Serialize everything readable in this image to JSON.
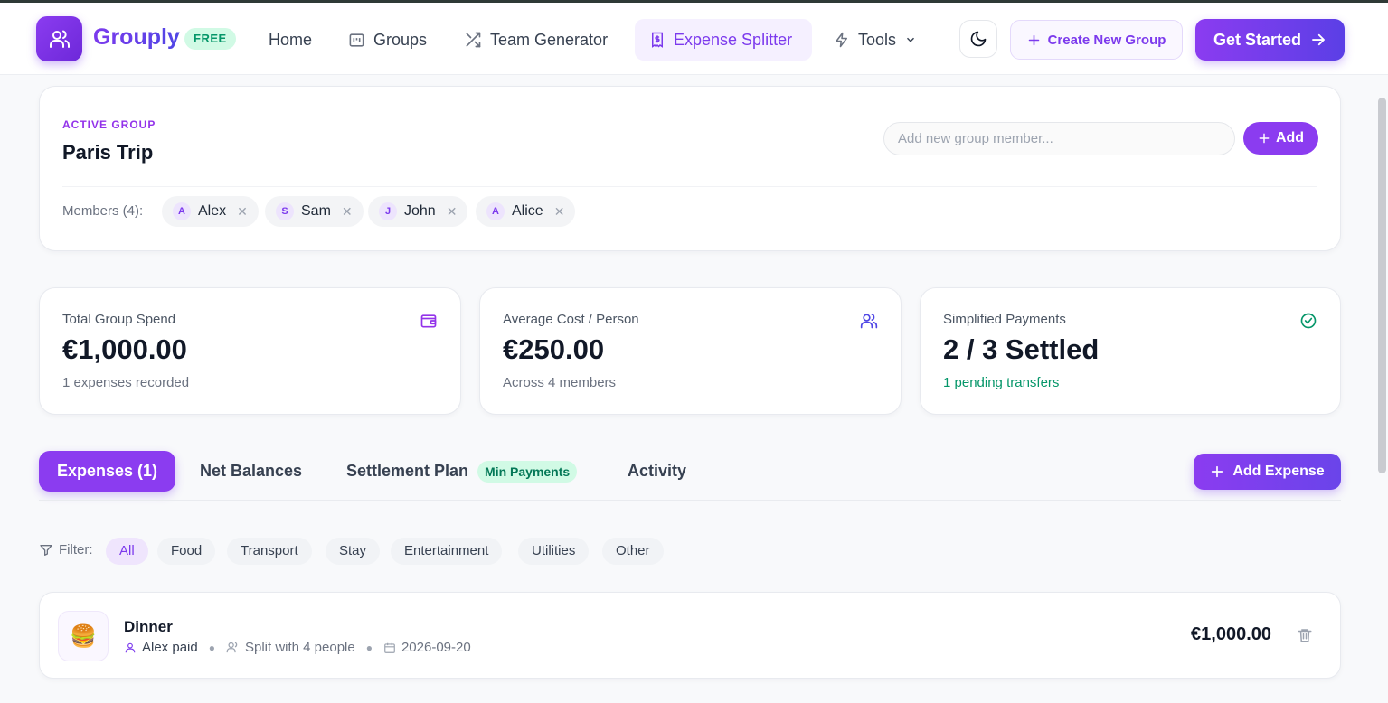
{
  "header": {
    "brand": "Grouply",
    "badge": "FREE",
    "nav": {
      "home": "Home",
      "groups": "Groups",
      "team_generator": "Team Generator",
      "expense_splitter": "Expense Splitter",
      "tools": "Tools"
    },
    "create_group": "Create New Group",
    "get_started": "Get Started",
    "colors": {
      "accent": "#8b3cf0",
      "accent_dark": "#5b3fe6",
      "badge_bg": "#d1fae5",
      "badge_text": "#059669"
    }
  },
  "group": {
    "label": "ACTIVE GROUP",
    "name": "Paris Trip",
    "member_input_placeholder": "Add new group member...",
    "add_label": "Add",
    "members_label": "Members (4):",
    "members": [
      {
        "initial": "A",
        "name": "Alex"
      },
      {
        "initial": "S",
        "name": "Sam"
      },
      {
        "initial": "J",
        "name": "John"
      },
      {
        "initial": "A",
        "name": "Alice"
      }
    ]
  },
  "stats": [
    {
      "title": "Total Group Spend",
      "value": "€1,000.00",
      "sub": "1 expenses recorded",
      "icon": "wallet-icon"
    },
    {
      "title": "Average Cost / Person",
      "value": "€250.00",
      "sub": "Across 4 members",
      "icon": "users-icon"
    },
    {
      "title": "Simplified Payments",
      "value": "2 / 3 Settled",
      "sub": "1 pending transfers",
      "icon": "check-circle-icon"
    }
  ],
  "tabs": {
    "expenses": "Expenses (1)",
    "net_balances": "Net Balances",
    "settlement_plan": "Settlement Plan",
    "settlement_badge": "Min Payments",
    "activity": "Activity",
    "add_expense": "Add Expense"
  },
  "filter": {
    "label": "Filter:",
    "options": [
      "All",
      "Food",
      "Transport",
      "Stay",
      "Entertainment",
      "Utilities",
      "Other"
    ],
    "selected": "All"
  },
  "expenses": [
    {
      "icon": "🍔",
      "title": "Dinner",
      "payer": "Alex paid",
      "split": "Split with 4 people",
      "date": "2026-09-20",
      "amount": "€1,000.00"
    }
  ]
}
